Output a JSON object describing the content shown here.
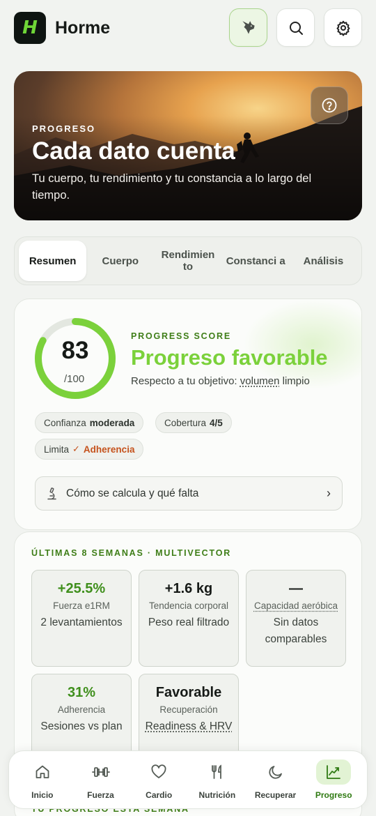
{
  "app": {
    "logo_text": "H",
    "title": "Horme"
  },
  "header_buttons": [
    {
      "name": "wolf-mode",
      "icon": "wolf-icon"
    },
    {
      "name": "search",
      "icon": "search-icon"
    },
    {
      "name": "settings",
      "icon": "gear-icon"
    }
  ],
  "hero": {
    "kicker": "PROGRESO",
    "title": "Cada dato cuenta",
    "subtitle": "Tu cuerpo, tu rendimiento y tu constancia a lo largo del tiempo.",
    "help_icon": "question-circle-icon"
  },
  "tabs": [
    {
      "label": "Resumen",
      "active": true
    },
    {
      "label": "Cuerpo",
      "active": false
    },
    {
      "label": "Rendimien to",
      "active": false
    },
    {
      "label": "Constanci a",
      "active": false
    },
    {
      "label": "Análisis",
      "active": false
    }
  ],
  "score": {
    "value": "83",
    "max": "/100",
    "fraction": 0.83,
    "kicker": "PROGRESS SCORE",
    "title": "Progreso favorable",
    "subtitle_prefix": "Respecto a tu objetivo: ",
    "subtitle_goal": "volumen",
    "subtitle_suffix": " limpio",
    "chips": {
      "confidence_label": "Confianza",
      "confidence_value": "moderada",
      "coverage_label": "Cobertura",
      "coverage_value": "4/5",
      "limit_label": "Limita",
      "limit_value": "Adherencia"
    },
    "calc_button": {
      "label": "Cómo se calcula y qué falta",
      "icon": "microscope-icon"
    }
  },
  "weeks": {
    "kicker": "ÚLTIMAS 8 SEMANAS · MULTIVECTOR",
    "metrics": [
      {
        "value": "+25.5%",
        "label": "Fuerza e1RM",
        "detail": "2 levantamientos"
      },
      {
        "value": "+1.6 kg",
        "label": "Tendencia corporal",
        "detail": "Peso real filtrado"
      },
      {
        "value": "—",
        "label": "Capacidad aeróbica",
        "detail": "Sin datos comparables"
      },
      {
        "value": "31%",
        "label": "Adherencia",
        "detail": "Sesiones vs plan"
      },
      {
        "value": "Favorable",
        "label": "Recuperación",
        "detail": "Readiness & HRV"
      }
    ]
  },
  "next_section_kicker": "TU PROGRESO ESTA SEMANA",
  "nav": [
    {
      "label": "Inicio",
      "icon": "home-icon",
      "active": false
    },
    {
      "label": "Fuerza",
      "icon": "dumbbell-icon",
      "active": false
    },
    {
      "label": "Cardio",
      "icon": "heart-icon",
      "active": false
    },
    {
      "label": "Nutrición",
      "icon": "utensils-icon",
      "active": false
    },
    {
      "label": "Recuperar",
      "icon": "moon-icon",
      "active": false
    },
    {
      "label": "Progreso",
      "icon": "chart-line-icon",
      "active": true
    }
  ],
  "colors": {
    "accent": "#7bd13b",
    "accent_dark": "#3f7e18",
    "warning": "#c5521c"
  }
}
